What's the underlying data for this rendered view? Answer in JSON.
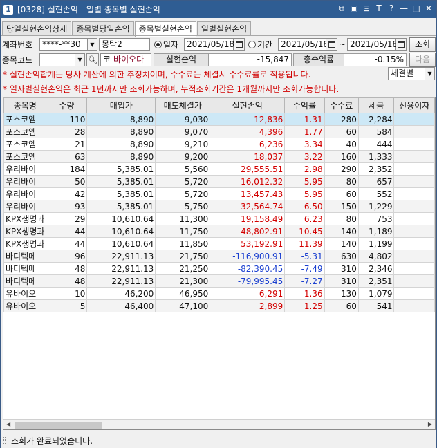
{
  "window": {
    "icon_label": "1",
    "title": "[0328] 실현손익 - 일별 종목별 실현손익"
  },
  "titlebar_icons": [
    "window-link-icon",
    "window-restore-icon",
    "window-arrange-icon",
    "font-size-icon",
    "help-icon",
    "minimize-icon",
    "maximize-icon",
    "close-icon"
  ],
  "titlebar_glyphs": [
    "⧉",
    "▣",
    "⊟",
    "T",
    "?",
    "—",
    "□",
    "✕"
  ],
  "tabs": [
    {
      "label": "당일실현손익상세",
      "active": false
    },
    {
      "label": "종목별당일손익",
      "active": false
    },
    {
      "label": "종목별실현손익",
      "active": true
    },
    {
      "label": "일별실현손익",
      "active": false
    }
  ],
  "form": {
    "account_label": "계좌번호",
    "account_value": "****-**30",
    "account_name": "몽탁2",
    "radio_date_label": "일자",
    "date_value": "2021/05/18",
    "radio_period_label": "기간",
    "period_from": "2021/05/18",
    "period_sep": "~",
    "period_to": "2021/05/18",
    "search_button": "조회",
    "stock_code_label": "종목코드",
    "stock_code_value": "",
    "stock_prefix": "코",
    "stock_name": "바이오다",
    "realized_label": "실현손익",
    "realized_value": "-15,847",
    "total_return_label": "총수익률",
    "total_return_value": "-0.15%",
    "next_button": "다음",
    "note1": "* 실현손익합계는 당사 계산에 의한 추정치이며, 수수료는 체결시 수수료률로 적용됩니다.",
    "note2": "* 일자별실현손익은 최근 1년까지만 조회가능하며, 누적조회기간은 1개월까지만 조회가능합니다.",
    "sort_select": "체결별"
  },
  "table": {
    "headers": [
      "종목명",
      "수량",
      "매입가",
      "매도체결가",
      "실현손익",
      "수익률",
      "수수료",
      "세금",
      "신용이자"
    ],
    "rows": [
      [
        "포스코엠",
        "110",
        "8,890",
        "9,030",
        "12,836",
        "1.31",
        "280",
        "2,284",
        ""
      ],
      [
        "포스코엠",
        "28",
        "8,890",
        "9,070",
        "4,396",
        "1.77",
        "60",
        "584",
        ""
      ],
      [
        "포스코엠",
        "21",
        "8,890",
        "9,210",
        "6,236",
        "3.34",
        "40",
        "444",
        ""
      ],
      [
        "포스코엠",
        "63",
        "8,890",
        "9,200",
        "18,037",
        "3.22",
        "160",
        "1,333",
        ""
      ],
      [
        "우리바이",
        "184",
        "5,385.01",
        "5,560",
        "29,555.51",
        "2.98",
        "290",
        "2,352",
        ""
      ],
      [
        "우리바이",
        "50",
        "5,385.01",
        "5,720",
        "16,012.32",
        "5.95",
        "80",
        "657",
        ""
      ],
      [
        "우리바이",
        "42",
        "5,385.01",
        "5,720",
        "13,457.43",
        "5.95",
        "60",
        "552",
        ""
      ],
      [
        "우리바이",
        "93",
        "5,385.01",
        "5,750",
        "32,564.74",
        "6.50",
        "150",
        "1,229",
        ""
      ],
      [
        "KPX생명과",
        "29",
        "10,610.64",
        "11,300",
        "19,158.49",
        "6.23",
        "80",
        "753",
        ""
      ],
      [
        "KPX생명과",
        "44",
        "10,610.64",
        "11,750",
        "48,802.91",
        "10.45",
        "140",
        "1,189",
        ""
      ],
      [
        "KPX생명과",
        "44",
        "10,610.64",
        "11,850",
        "53,192.91",
        "11.39",
        "140",
        "1,199",
        ""
      ],
      [
        "바디텍메",
        "96",
        "22,911.13",
        "21,750",
        "-116,900.91",
        "-5.31",
        "630",
        "4,802",
        ""
      ],
      [
        "바디텍메",
        "48",
        "22,911.13",
        "21,250",
        "-82,390.45",
        "-7.49",
        "310",
        "2,346",
        ""
      ],
      [
        "바디텍메",
        "48",
        "22,911.13",
        "21,300",
        "-79,995.45",
        "-7.27",
        "310",
        "2,351",
        ""
      ],
      [
        "유바이오",
        "10",
        "46,200",
        "46,950",
        "6,291",
        "1.36",
        "130",
        "1,079",
        ""
      ],
      [
        "유바이오",
        "5",
        "46,400",
        "47,100",
        "2,899",
        "1.25",
        "60",
        "541",
        ""
      ]
    ]
  },
  "status_text": "조회가 완료되었습니다."
}
